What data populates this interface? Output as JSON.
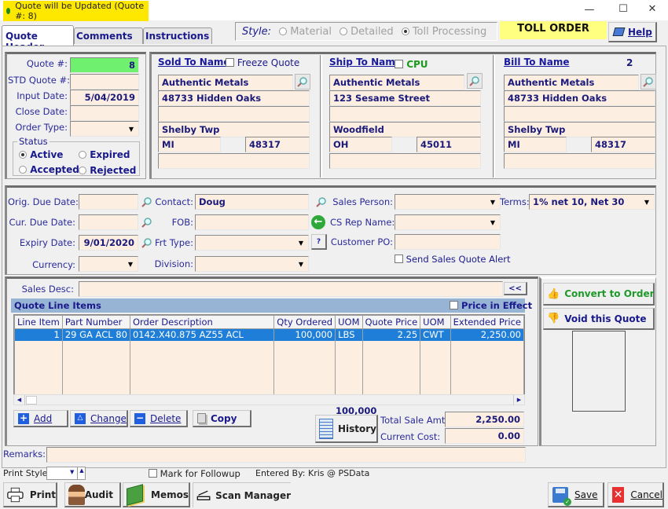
{
  "titlebar": {
    "title": "Quote will be Updated  (Quote #: 8)",
    "bg_color": "#ffe800"
  },
  "window_controls": {
    "minimize": "—",
    "maximize": "☐",
    "close": "✕"
  },
  "tabs": [
    {
      "label": "Quote Header",
      "active": true
    },
    {
      "label": "Comments",
      "active": false
    },
    {
      "label": "Instructions",
      "active": false
    }
  ],
  "style_group": {
    "label": "Style:",
    "options": [
      {
        "label": "Material",
        "selected": false
      },
      {
        "label": "Detailed",
        "selected": false
      },
      {
        "label": "Toll Processing",
        "selected": true
      }
    ]
  },
  "order_badge": {
    "text": "TOLL ORDER",
    "bg_color": "#ffff80"
  },
  "help_button": {
    "label": "Help"
  },
  "quote_info": {
    "quote_no_label": "Quote #:",
    "quote_no": "8",
    "std_quote_label": "STD Quote #:",
    "std_quote": "",
    "input_date_label": "Input Date:",
    "input_date": "5/04/2019",
    "close_date_label": "Close Date:",
    "close_date": "",
    "order_type_label": "Order Type:",
    "order_type": "",
    "status_label": "Status",
    "status_options": [
      {
        "label": "Active",
        "selected": true
      },
      {
        "label": "Expired",
        "selected": false
      },
      {
        "label": "Accepted",
        "selected": false
      },
      {
        "label": "Rejected",
        "selected": false
      }
    ]
  },
  "sold_to": {
    "title": "Sold To Name",
    "freeze_label": "Freeze Quote",
    "freeze_checked": false,
    "name": "Authentic Metals",
    "address1": "48733 Hidden Oaks",
    "address2": "",
    "city": "Shelby Twp",
    "state": "MI",
    "zip": "48317",
    "extra": ""
  },
  "ship_to": {
    "title": "Ship To Name",
    "cpu_label": "CPU",
    "cpu_checked": false,
    "name": "Authentic Metals",
    "address1": "123 Sesame Street",
    "address2": "",
    "city": "Woodfield",
    "state": "OH",
    "zip": "45011",
    "extra": ""
  },
  "bill_to": {
    "title": "Bill To Name",
    "count": "2",
    "name": "Authentic Metals",
    "address1": "48733 Hidden Oaks",
    "address2": "",
    "city": "Shelby Twp",
    "state": "MI",
    "zip": "48317",
    "extra": ""
  },
  "details": {
    "orig_due_label": "Orig. Due Date:",
    "orig_due": "",
    "cur_due_label": "Cur. Due Date:",
    "cur_due": "",
    "expiry_label": "Expiry Date:",
    "expiry": "9/01/2020",
    "currency_label": "Currency:",
    "currency": "",
    "contact_label": "Contact:",
    "contact": "Doug",
    "fob_label": "FOB:",
    "fob": "",
    "frt_label": "Frt Type:",
    "frt": "",
    "frt_help": "?",
    "division_label": "Division:",
    "division": "",
    "sales_person_label": "Sales Person:",
    "sales_person": "",
    "terms_label": "Terms:",
    "terms": "1% net 10, Net 30",
    "cs_rep_label": "CS Rep Name:",
    "cs_rep": "",
    "customer_po_label": "Customer PO:",
    "customer_po": "",
    "alert_label": "Send Sales Quote Alert",
    "alert_checked": false
  },
  "sales_desc": {
    "label": "Sales Desc:",
    "value": "",
    "collapse_label": "<<"
  },
  "line_items": {
    "title": "Quote Line Items",
    "price_in_effect_label": "Price in Effect",
    "price_in_effect_checked": false,
    "columns": [
      "Line Item",
      "Part Number",
      "Order Description",
      "Qty Ordered",
      "UOM",
      "Quote Price",
      "UOM",
      "Extended Price"
    ],
    "rows": [
      [
        "1",
        "29 GA ACL 80",
        "0142.X40.875 AZ55 ACL",
        "100,000",
        "LBS",
        "2.25",
        "CWT",
        "2,250.00"
      ]
    ],
    "selected_row": 0
  },
  "line_actions": {
    "add": "Add",
    "change": "Change",
    "delete": "Delete",
    "copy": "Copy"
  },
  "totals": {
    "qty_total": "100,000",
    "history_label": "History",
    "total_sale_label": "Total Sale Amt:",
    "total_sale": "2,250.00",
    "current_cost_label": "Current Cost:",
    "current_cost": "0.00"
  },
  "side_actions": {
    "convert": "Convert to Order",
    "void": "Void this Quote"
  },
  "remarks": {
    "label": "Remarks:",
    "value": ""
  },
  "footer": {
    "print_style_label": "Print Style:",
    "print_style": "",
    "followup_label": "Mark for Followup",
    "followup_checked": false,
    "entered_by": "Entered By: Kris @ PSData"
  },
  "bottom_buttons": {
    "print": "Print",
    "audit": "Audit",
    "memos": "Memos",
    "scan": "Scan Manager",
    "save": "Save",
    "cancel": "Cancel"
  }
}
